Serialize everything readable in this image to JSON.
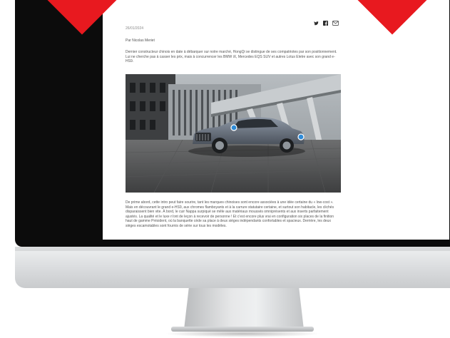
{
  "article": {
    "date": "26/01/2024",
    "author": "Par Nicolas Meriet",
    "intro": "Dernier constructeur chinois en date à débarquer sur notre marché, HongQi se distingue de ses compatriotes par son positionnement. Lui ne cherche pas à casser les prix, mais à concurrencer les BMW iX, Mercedes EQS SUV et autres Lotus Eletre avec son grand e-HS9.",
    "body": "De prime abord, cette intro peut faire sourire, tant les marques chinoises sont encore associées à une idée certaine du « low-cost ». Mais en découvrant le grand e-HS9, aux chromes flamboyants et à la carrure statutaire certaine, et surtout son habitacle, les clichés disparaissent bien vite. À bord, le cuir Nappa surpiqué se mêle aux matériaux moussés omniprésents et aux inserts parfaitement ajustés. La qualité et le luxe n'ont de leçon à recevoir de personne ! Et c'est encore plus vrai en configuration six places de la finition haut de gamme Président, où la banquette cède sa place à deux sièges indépendants confortables et spacieux. Derrière, les deux sièges escamotables sont fournis de série sur tous les modèles."
  },
  "social": {
    "icons": [
      "twitter-icon",
      "facebook-icon",
      "mail-icon"
    ]
  },
  "colors": {
    "accent": "#e8191f",
    "bezel": "#0c0c0c",
    "hotspot": "#2e8bd8",
    "car": "#6e7785"
  }
}
